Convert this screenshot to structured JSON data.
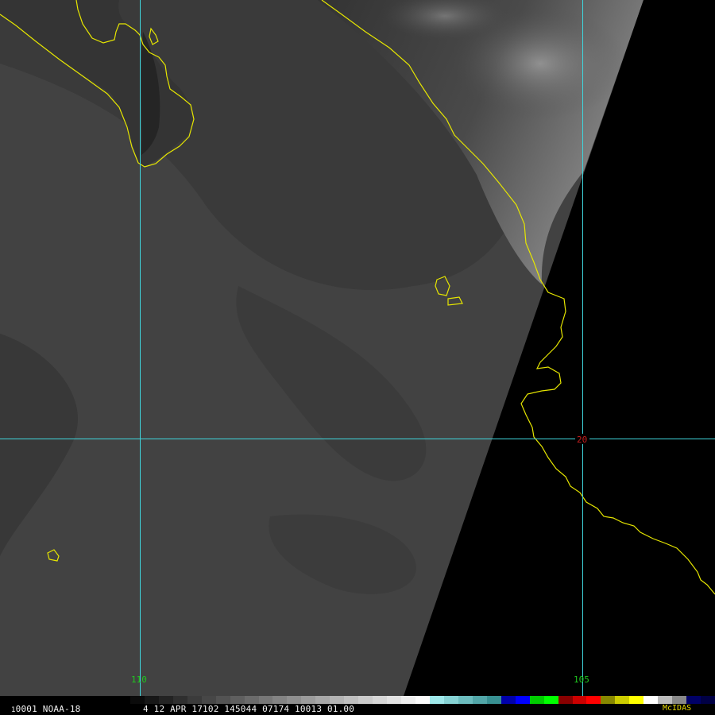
{
  "image": {
    "satellite": "NOAA-18",
    "frame_id": "0001",
    "frame_prefix": "1",
    "info_line": "4 12 APR 17102 145044 07174 10013 01.00",
    "software_label": "McIDAS"
  },
  "grid_labels": {
    "lon_110": "110",
    "lon_105": "105",
    "lat_20": "20"
  },
  "colors": {
    "grid_line": "#3fd6dd",
    "coastline": "#e6e600",
    "lon_label": "#1fc81f",
    "lat_label": "#c81e1e",
    "land_dark": "#2d2d2d",
    "sea_gray": "#444444",
    "no_data": "#000000",
    "status_text": "#f2f2f2",
    "mcidas_text": "#e6d900"
  },
  "colorbar": [
    "#000000",
    "#0b0b0b",
    "#171717",
    "#232323",
    "#2f2f2f",
    "#3b3b3b",
    "#474747",
    "#535353",
    "#5f5f5f",
    "#6b6b6b",
    "#777777",
    "#838383",
    "#8f8f8f",
    "#9b9b9b",
    "#a7a7a7",
    "#b3b3b3",
    "#bfbfbf",
    "#cbcbcb",
    "#d7d7d7",
    "#e3e3e3",
    "#efefef",
    "#fbfbfb",
    "#9fe8ea",
    "#86d2d4",
    "#6cbcbe",
    "#52a6a8",
    "#389092",
    "#0000aa",
    "#0000ff",
    "#00cc00",
    "#00ff00",
    "#880000",
    "#cc0000",
    "#ff0000",
    "#888800",
    "#cccc00",
    "#ffff00",
    "#ffffff",
    "#bbbbbb",
    "#888888",
    "#000066",
    "#000044"
  ]
}
